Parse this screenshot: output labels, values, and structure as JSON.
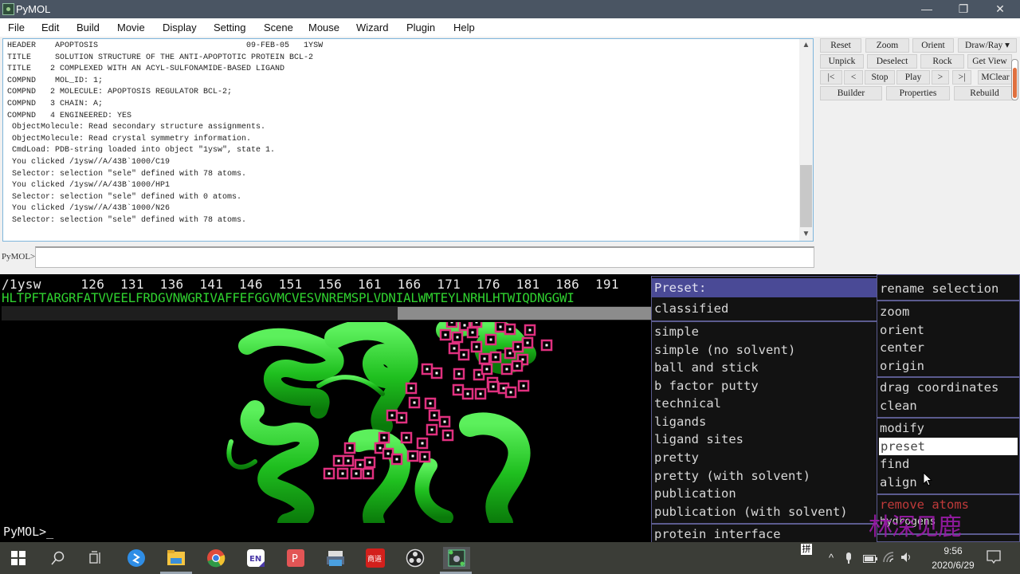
{
  "window": {
    "title": "PyMOL",
    "controls": {
      "minimize": "—",
      "maximize": "❐",
      "close": "✕"
    }
  },
  "menubar": [
    "File",
    "Edit",
    "Build",
    "Movie",
    "Display",
    "Setting",
    "Scene",
    "Mouse",
    "Wizard",
    "Plugin",
    "Help"
  ],
  "log": {
    "lines": [
      "HEADER    APOPTOSIS                               09-FEB-05   1YSW",
      "TITLE     SOLUTION STRUCTURE OF THE ANTI-APOPTOTIC PROTEIN BCL-2",
      "TITLE    2 COMPLEXED WITH AN ACYL-SULFONAMIDE-BASED LIGAND",
      "COMPND    MOL_ID: 1;",
      "COMPND   2 MOLECULE: APOPTOSIS REGULATOR BCL-2;",
      "COMPND   3 CHAIN: A;",
      "COMPND   4 ENGINEERED: YES",
      " ObjectMolecule: Read secondary structure assignments.",
      " ObjectMolecule: Read crystal symmetry information.",
      " CmdLoad: PDB-string loaded into object \"1ysw\", state 1.",
      " You clicked /1ysw//A/43B`1000/C19",
      " Selector: selection \"sele\" defined with 78 atoms.",
      " You clicked /1ysw//A/43B`1000/HP1",
      " Selector: selection \"sele\" defined with 0 atoms.",
      " You clicked /1ysw//A/43B`1000/N26",
      " Selector: selection \"sele\" defined with 78 atoms."
    ]
  },
  "command": {
    "prompt": "PyMOL>",
    "value": ""
  },
  "buttons": {
    "row1": [
      "Reset",
      "Zoom",
      "Orient",
      "Draw/Ray ▾"
    ],
    "row2": [
      "Unpick",
      "Deselect",
      "Rock",
      "Get View"
    ],
    "row3": [
      "|<",
      "<",
      "Stop",
      "Play",
      ">",
      ">|",
      "MClear"
    ],
    "row4": [
      "Builder",
      "Properties",
      "Rebuild"
    ]
  },
  "sequence": {
    "object": "/1ysw",
    "numbers_line": "/1ysw     126  131  136  141  146  151  156  161  166  171  176  181  186  191",
    "residues": "HLTPFTARGRFATVVEELFRDGVNWGRIVAFFEFGGVMCVESVNREMSPLVDNIALWMTEYLNRHLHTWIQDNGGWI"
  },
  "viewer": {
    "prompt": "PyMOL>_"
  },
  "preset_menu": {
    "header": "Preset:",
    "items": [
      "classified",
      "simple",
      "simple (no solvent)",
      "ball and stick",
      "b factor putty",
      "technical",
      "ligands",
      "ligand sites",
      "pretty",
      "pretty (with solvent)",
      "publication",
      "publication (with solvent)",
      "protein interface"
    ]
  },
  "action_menu": {
    "items": [
      "rename selection",
      "zoom",
      "orient",
      "center",
      "origin",
      "drag coordinates",
      "clean",
      "modify",
      "preset",
      "find",
      "align",
      "remove atoms",
      "hydrogens"
    ],
    "highlighted": "preset",
    "danger": "remove atoms"
  },
  "watermark": "林深见鹿",
  "taskbar": {
    "icons": [
      "windows-start",
      "search",
      "task-view",
      "baidu-netdisk",
      "file-explorer",
      "chrome",
      "en-dictionary",
      "pdf-reader",
      "printer-app",
      "red-app",
      "obs-studio",
      "pymol"
    ],
    "tray": {
      "ime": "拼",
      "time": "9:56",
      "date": "2020/6/29"
    }
  },
  "colors": {
    "titlebar": "#4a5563",
    "ribbon": "#22c022",
    "selection": "#e0307f",
    "menu_header": "#4a4a96",
    "sequence": "#2fd12f"
  }
}
